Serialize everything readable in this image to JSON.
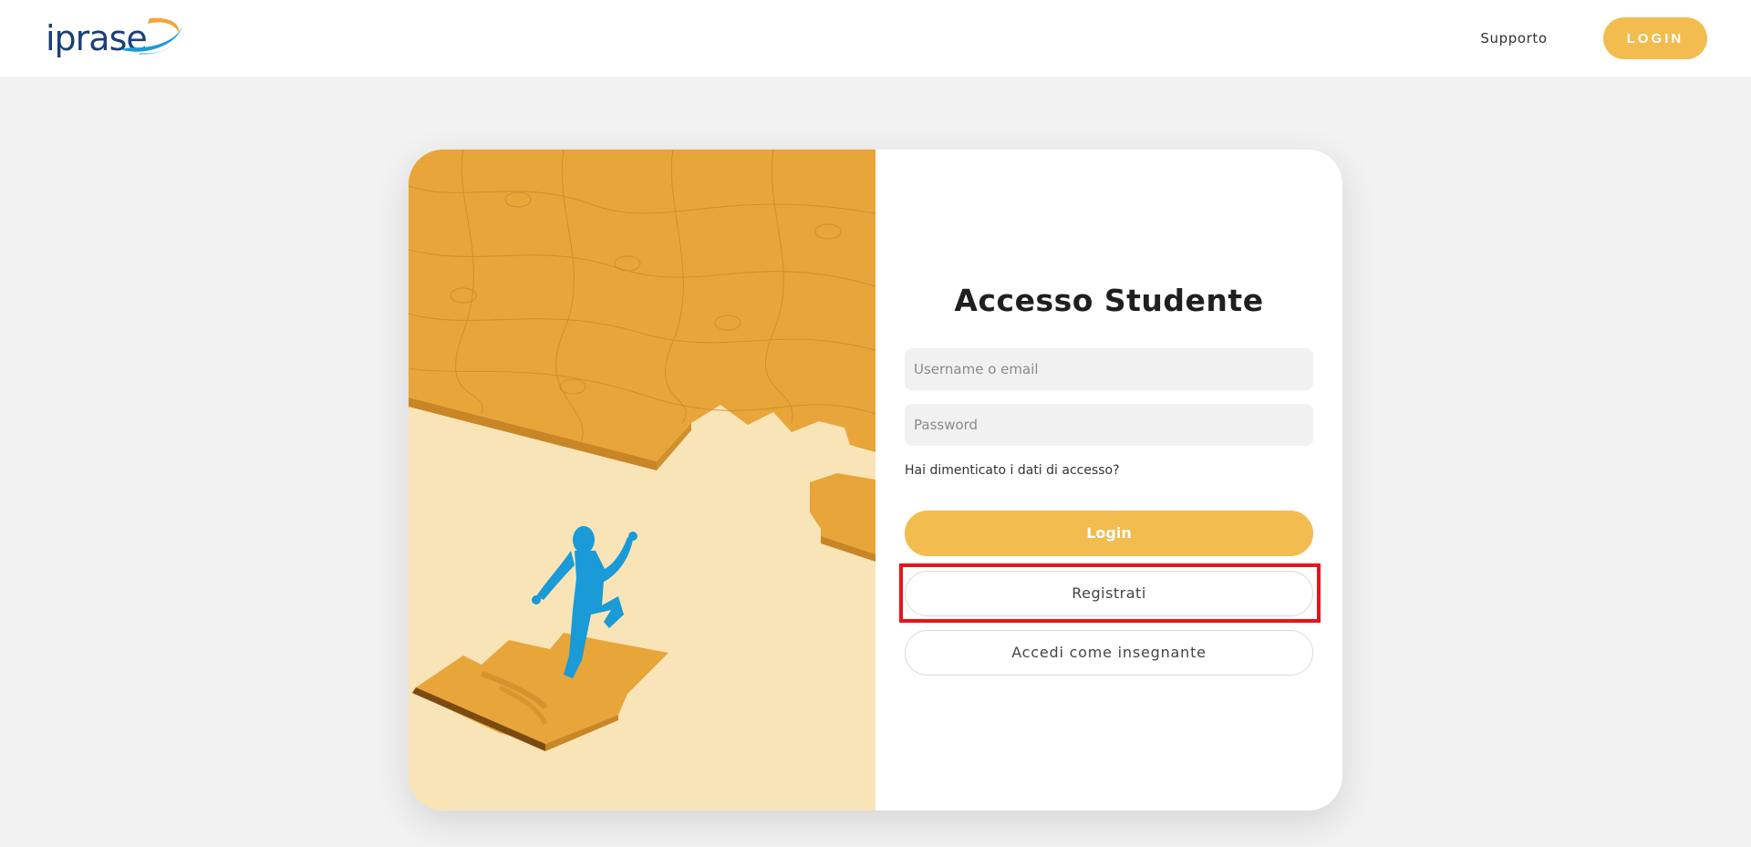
{
  "header": {
    "logo_text": "iprase",
    "nav_support": "Supporto",
    "nav_login": "LOGIN"
  },
  "login_card": {
    "title": "Accesso Studente",
    "username": {
      "placeholder": "Username o email",
      "value": ""
    },
    "password": {
      "placeholder": "Password",
      "value": ""
    },
    "forgot_link": "Hai dimenticato i dati di accesso?",
    "login_button": "Login",
    "register_button": "Registrati",
    "teacher_button": "Accedi come insegnante"
  },
  "illustration": {
    "icons": [
      "puzzle-illustration",
      "running-figure-icon"
    ]
  },
  "colors": {
    "accent": "#f3bc4f",
    "puzzle": "#e8a53a",
    "puzzle_background": "#f9e4b8",
    "figure": "#1a9ad6",
    "highlight": "#e8131b",
    "logo_blue": "#1b3f7a"
  }
}
